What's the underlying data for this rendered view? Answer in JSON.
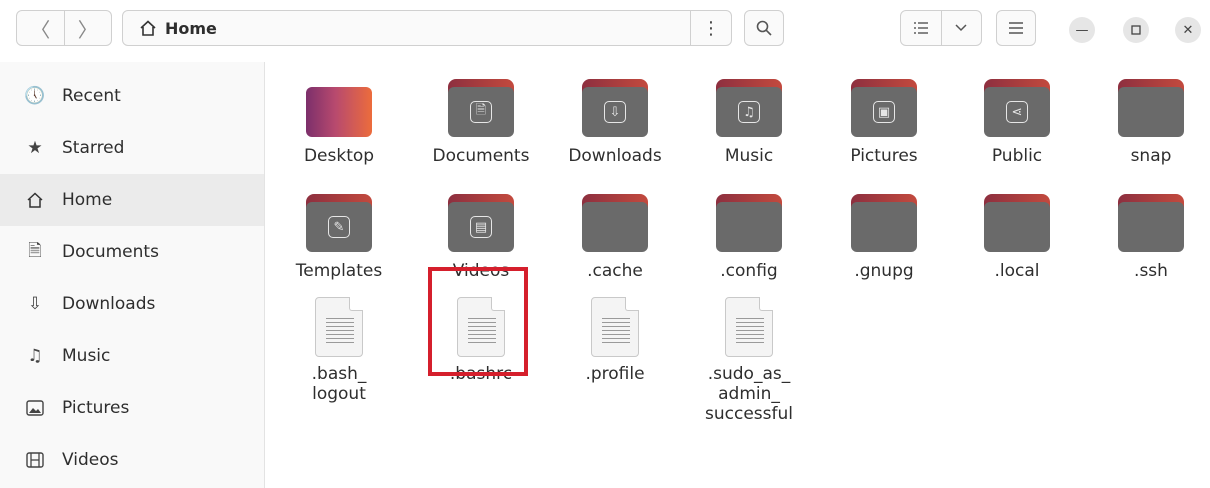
{
  "header": {
    "back_icon": "back-chevron",
    "forward_icon": "forward-chevron",
    "location_icon": "home-icon",
    "location": "Home",
    "location_menu_icon": "vertical-dots",
    "search_icon": "search-icon",
    "view_icon": "list-view-icon",
    "view_dropdown_icon": "chevron-down",
    "menu_icon": "hamburger",
    "window_controls": [
      "minimize",
      "maximize",
      "close"
    ]
  },
  "sidebar": {
    "items": [
      {
        "label": "Recent",
        "icon": "clock-icon",
        "glyph": "🕔",
        "active": false
      },
      {
        "label": "Starred",
        "icon": "star-icon",
        "glyph": "★",
        "active": false
      },
      {
        "label": "Home",
        "icon": "home-icon",
        "glyph": "⌂",
        "active": true
      },
      {
        "label": "Documents",
        "icon": "document-icon",
        "glyph": "🗎",
        "active": false
      },
      {
        "label": "Downloads",
        "icon": "download-icon",
        "glyph": "⇩",
        "active": false
      },
      {
        "label": "Music",
        "icon": "music-icon",
        "glyph": "♫",
        "active": false
      },
      {
        "label": "Pictures",
        "icon": "picture-icon",
        "glyph": "🖼",
        "active": false
      },
      {
        "label": "Videos",
        "icon": "film-icon",
        "glyph": "▤",
        "active": false
      }
    ]
  },
  "files": [
    {
      "name": "Desktop",
      "kind": "folder",
      "badge": "desktop"
    },
    {
      "name": "Documents",
      "kind": "folder",
      "badge": "document"
    },
    {
      "name": "Downloads",
      "kind": "folder",
      "badge": "download"
    },
    {
      "name": "Music",
      "kind": "folder",
      "badge": "music"
    },
    {
      "name": "Pictures",
      "kind": "folder",
      "badge": "picture"
    },
    {
      "name": "Public",
      "kind": "folder",
      "badge": "share"
    },
    {
      "name": "snap",
      "kind": "folder",
      "badge": "none"
    },
    {
      "name": "Templates",
      "kind": "folder",
      "badge": "template"
    },
    {
      "name": "Videos",
      "kind": "folder",
      "badge": "film"
    },
    {
      "name": ".cache",
      "kind": "folder",
      "badge": "none"
    },
    {
      "name": ".config",
      "kind": "folder",
      "badge": "none"
    },
    {
      "name": ".gnupg",
      "kind": "folder",
      "badge": "none"
    },
    {
      "name": ".local",
      "kind": "folder",
      "badge": "none"
    },
    {
      "name": ".ssh",
      "kind": "folder",
      "badge": "none"
    },
    {
      "name": ".bash_\nlogout",
      "kind": "text-file",
      "badge": "none"
    },
    {
      "name": ".bashrc",
      "kind": "text-file",
      "badge": "none",
      "highlighted": true
    },
    {
      "name": ".profile",
      "kind": "text-file",
      "badge": "none"
    },
    {
      "name": ".sudo_as_\nadmin_\nsuccessful",
      "kind": "text-file",
      "badge": "none"
    }
  ],
  "colors": {
    "highlight_box": "#d51f2c",
    "folder_body": "#6a6a6a",
    "folder_tab_start": "#8d2f3f",
    "folder_tab_end": "#c34a3e",
    "sidebar_bg": "#f9f9f9",
    "sidebar_active": "#ebebeb"
  }
}
